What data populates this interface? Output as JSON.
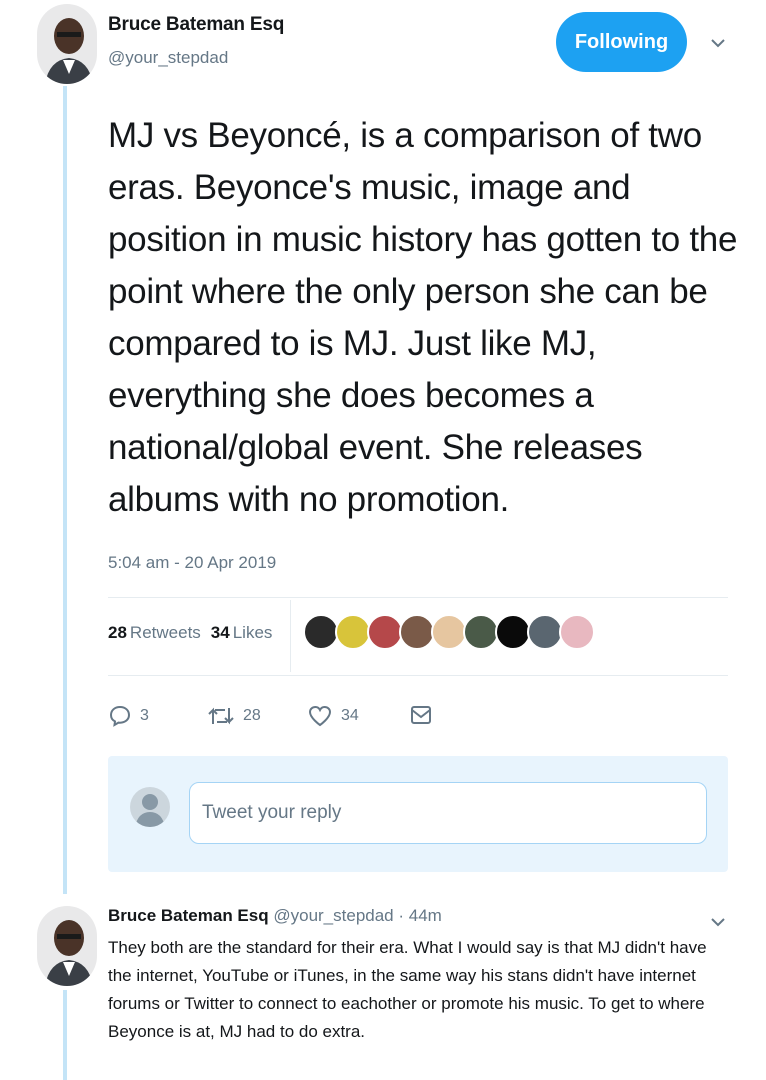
{
  "tweet": {
    "author_name": "Bruce Bateman Esq",
    "author_handle": "@your_stepdad",
    "follow_label": "Following",
    "text": "MJ vs Beyoncé, is a comparison of two eras. Beyonce's music, image and position in music history has gotten to the point where the only person she can be compared to is MJ. Just like MJ, everything she does becomes a national/global event. She releases albums with no promotion.",
    "timestamp": "5:04 am - 20 Apr 2019",
    "retweets_count": "28",
    "retweets_label": "Retweets",
    "likes_count": "34",
    "likes_label": "Likes",
    "actions": {
      "replies": "3",
      "retweets": "28",
      "likes": "34"
    }
  },
  "likers": [
    {
      "color": "#2a2a2a"
    },
    {
      "color": "#d8c43a"
    },
    {
      "color": "#b5484a"
    },
    {
      "color": "#7a5a48"
    },
    {
      "color": "#e6c6a0"
    },
    {
      "color": "#4a5a48"
    },
    {
      "color": "#0a0a0a"
    },
    {
      "color": "#5a6670"
    },
    {
      "color": "#e8b8c0"
    }
  ],
  "reply_composer": {
    "placeholder": "Tweet your reply"
  },
  "reply": {
    "author_name": "Bruce Bateman Esq",
    "meta": "@your_stepdad · 44m",
    "text": "They both are the standard for their era. What I would say is that MJ didn't have the internet, YouTube or iTunes, in the same way his stans didn't have internet forums or Twitter to connect to eachother or promote his music. To get to where Beyonce is at, MJ had to do extra."
  },
  "colors": {
    "accent": "#1da1f2",
    "muted": "#657786",
    "thread_line": "#c4e4f7",
    "composer_bg": "#e8f4fd"
  }
}
